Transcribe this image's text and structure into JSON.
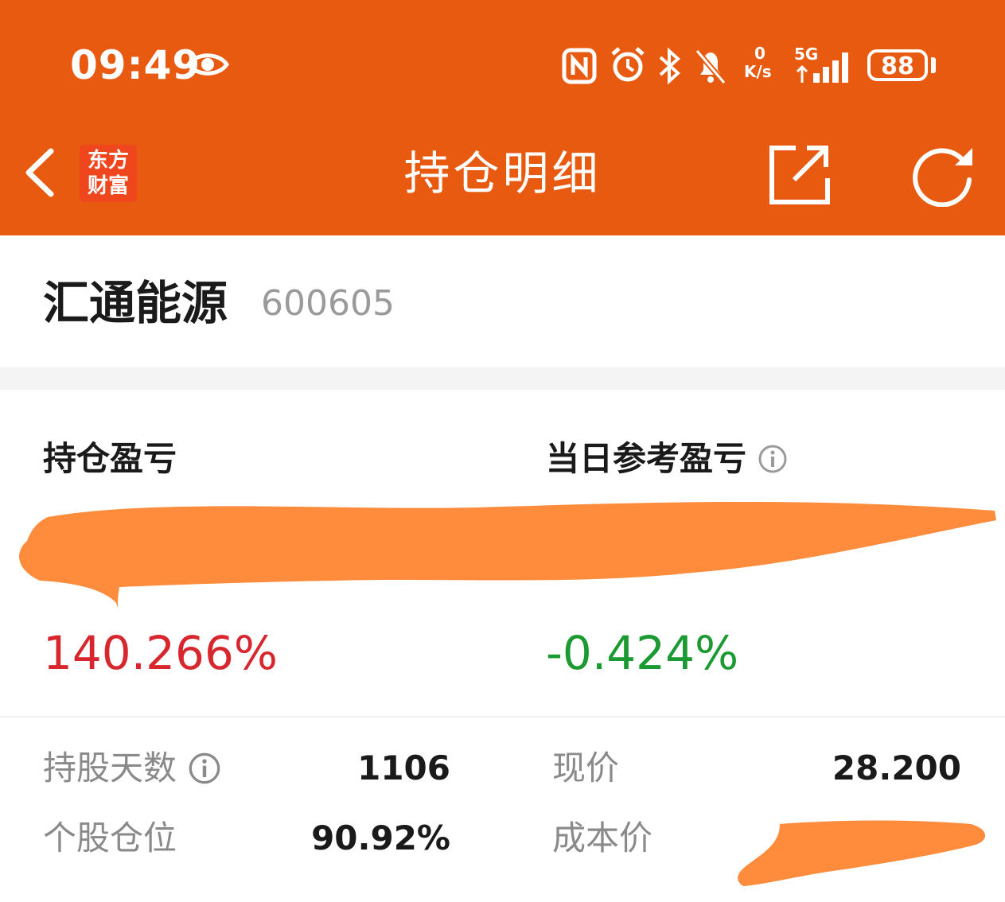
{
  "status_bar": {
    "time": "09:49",
    "net_speed_value": "0",
    "net_speed_unit": "K/s",
    "network_label": "5G",
    "battery_level": "88"
  },
  "nav": {
    "logo_line1": "东方",
    "logo_line2": "财富",
    "title": "持仓明细"
  },
  "stock": {
    "name": "汇通能源",
    "code": "600605"
  },
  "pnl": {
    "position_label": "持仓盈亏",
    "daily_label": "当日参考盈亏",
    "position_pct": "140.266%",
    "daily_pct": "-0.424%"
  },
  "details": {
    "hold_days_label": "持股天数",
    "hold_days_value": "1106",
    "position_ratio_label": "个股仓位",
    "position_ratio_value": "90.92%",
    "price_label": "现价",
    "price_value": "28.200",
    "cost_label": "成本价"
  },
  "colors": {
    "header_bg": "#e85a0f",
    "logo_bg": "#f0461e",
    "profit_red": "#d8262e",
    "loss_green": "#1c9a32",
    "redaction": "#fe8c3c"
  }
}
